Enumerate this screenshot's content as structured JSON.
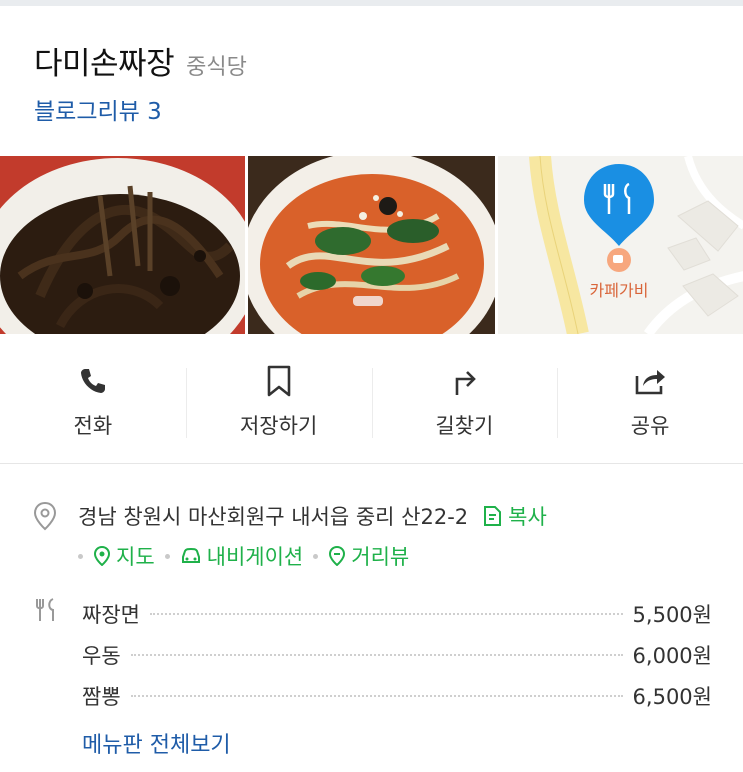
{
  "place": {
    "name": "다미손짜장",
    "category": "중식당",
    "blog_review": "블로그리뷰 3"
  },
  "map_preview": {
    "label": "카페가비"
  },
  "actions": [
    {
      "label": "전화",
      "icon": "phone-icon"
    },
    {
      "label": "저장하기",
      "icon": "bookmark-icon"
    },
    {
      "label": "길찾기",
      "icon": "directions-icon"
    },
    {
      "label": "공유",
      "icon": "share-icon"
    }
  ],
  "address": {
    "text": "경남 창원시 마산회원구 내서읍 중리 산22-2",
    "copy_label": "복사",
    "links": [
      {
        "label": "지도",
        "icon": "map-pin-icon"
      },
      {
        "label": "내비게이션",
        "icon": "car-icon"
      },
      {
        "label": "거리뷰",
        "icon": "streetview-icon"
      }
    ]
  },
  "menu": {
    "items": [
      {
        "name": "짜장면",
        "price": "5,500원"
      },
      {
        "name": "우동",
        "price": "6,000원"
      },
      {
        "name": "짬뽕",
        "price": "6,500원"
      }
    ],
    "view_all": "메뉴판 전체보기"
  },
  "colors": {
    "link_blue": "#1f5ca8",
    "accent_green": "#1fb14a",
    "map_pin_blue": "#1a8fe3"
  }
}
